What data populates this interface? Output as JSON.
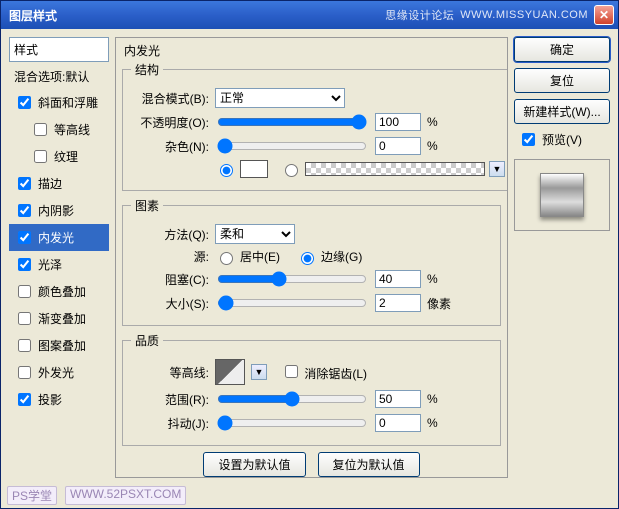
{
  "title": "图层样式",
  "watermark1": "思缘设计论坛",
  "watermark2": "WWW.MISSYUAN.COM",
  "styles": {
    "header": "样式",
    "blending": "混合选项:默认",
    "items": [
      {
        "label": "斜面和浮雕",
        "checked": true,
        "indent": false
      },
      {
        "label": "等高线",
        "checked": false,
        "indent": true
      },
      {
        "label": "纹理",
        "checked": false,
        "indent": true
      },
      {
        "label": "描边",
        "checked": true,
        "indent": false
      },
      {
        "label": "内阴影",
        "checked": true,
        "indent": false
      },
      {
        "label": "内发光",
        "checked": true,
        "indent": false,
        "selected": true
      },
      {
        "label": "光泽",
        "checked": true,
        "indent": false
      },
      {
        "label": "颜色叠加",
        "checked": false,
        "indent": false
      },
      {
        "label": "渐变叠加",
        "checked": false,
        "indent": false
      },
      {
        "label": "图案叠加",
        "checked": false,
        "indent": false
      },
      {
        "label": "外发光",
        "checked": false,
        "indent": false
      },
      {
        "label": "投影",
        "checked": true,
        "indent": false
      }
    ]
  },
  "panel": {
    "title": "内发光",
    "structure": {
      "legend": "结构",
      "blend_label": "混合模式(B):",
      "blend_value": "正常",
      "opacity_label": "不透明度(O):",
      "opacity_value": "100",
      "percent": "%",
      "noise_label": "杂色(N):",
      "noise_value": "0",
      "color_radio_solid": "",
      "color_radio_grad": ""
    },
    "elements": {
      "legend": "图素",
      "technique_label": "方法(Q):",
      "technique_value": "柔和",
      "source_label": "源:",
      "source_center": "居中(E)",
      "source_edge": "边缘(G)",
      "choke_label": "阻塞(C):",
      "choke_value": "40",
      "size_label": "大小(S):",
      "size_value": "2",
      "px": "像素"
    },
    "quality": {
      "legend": "品质",
      "contour_label": "等高线:",
      "antialias": "消除锯齿(L)",
      "range_label": "范围(R):",
      "range_value": "50",
      "jitter_label": "抖动(J):",
      "jitter_value": "0"
    },
    "footer": {
      "set_default": "设置为默认值",
      "reset_default": "复位为默认值"
    }
  },
  "buttons": {
    "ok": "确定",
    "cancel": "复位",
    "new_style": "新建样式(W)...",
    "preview": "预览(V)"
  },
  "bottom": {
    "wm1": "PS学堂",
    "wm2": "WWW.52PSXT.COM"
  }
}
